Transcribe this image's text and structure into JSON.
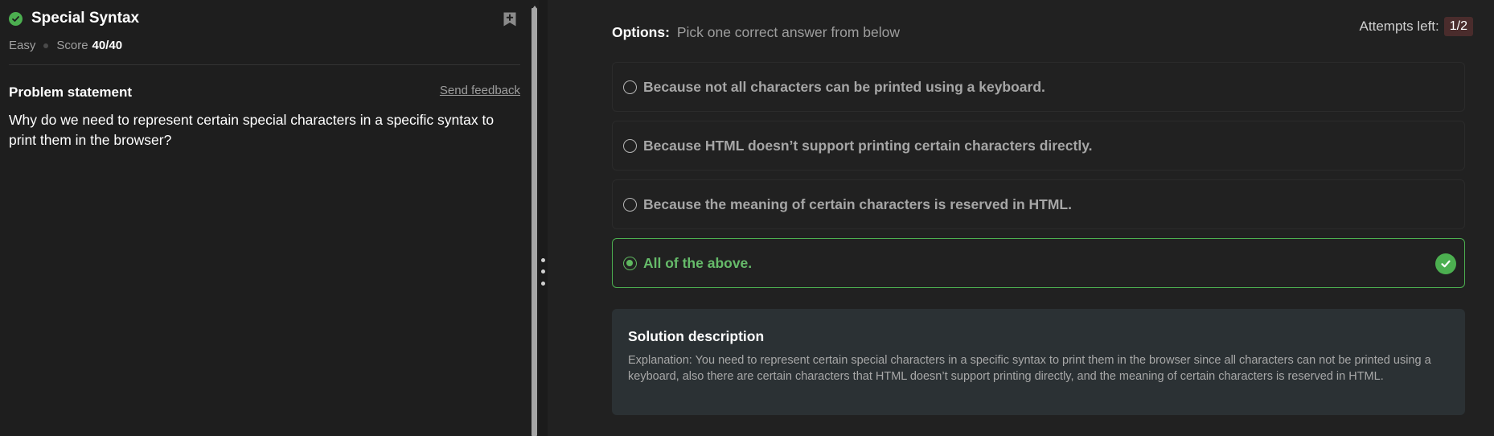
{
  "problem": {
    "title": "Special Syntax",
    "difficulty": "Easy",
    "score_label": "Score",
    "score_value": "40/40"
  },
  "statement": {
    "heading": "Problem statement",
    "feedback_link": "Send feedback",
    "text": "Why do we need to represent certain special characters in a specific syntax to print them in the browser?"
  },
  "quiz": {
    "options_label": "Options:",
    "options_hint": "Pick one correct answer from below",
    "attempts_label": "Attempts left:",
    "attempts_value": "1/2",
    "options": [
      {
        "label": "Because not all characters can be printed using a keyboard.",
        "selected": false
      },
      {
        "label": "Because HTML doesn’t support printing certain characters directly.",
        "selected": false
      },
      {
        "label": "Because the meaning of certain characters is reserved in HTML.",
        "selected": false
      },
      {
        "label": "All of the above.",
        "selected": true,
        "correct": true
      }
    ]
  },
  "solution": {
    "title": "Solution description",
    "text": "Explanation: You need to represent certain special characters in a specific syntax to print them in the browser since all characters can not be printed using a keyboard, also there are certain characters that HTML doesn’t support printing directly, and the meaning of certain characters is reserved in HTML."
  },
  "colors": {
    "accent_green": "#4caf50",
    "background": "#212121",
    "solution_bg": "#2b3134",
    "attempts_badge": "#4a2c2c"
  },
  "icons": [
    "check-circle-icon",
    "bookmark-add-icon",
    "radio-icon",
    "correct-check-icon"
  ]
}
